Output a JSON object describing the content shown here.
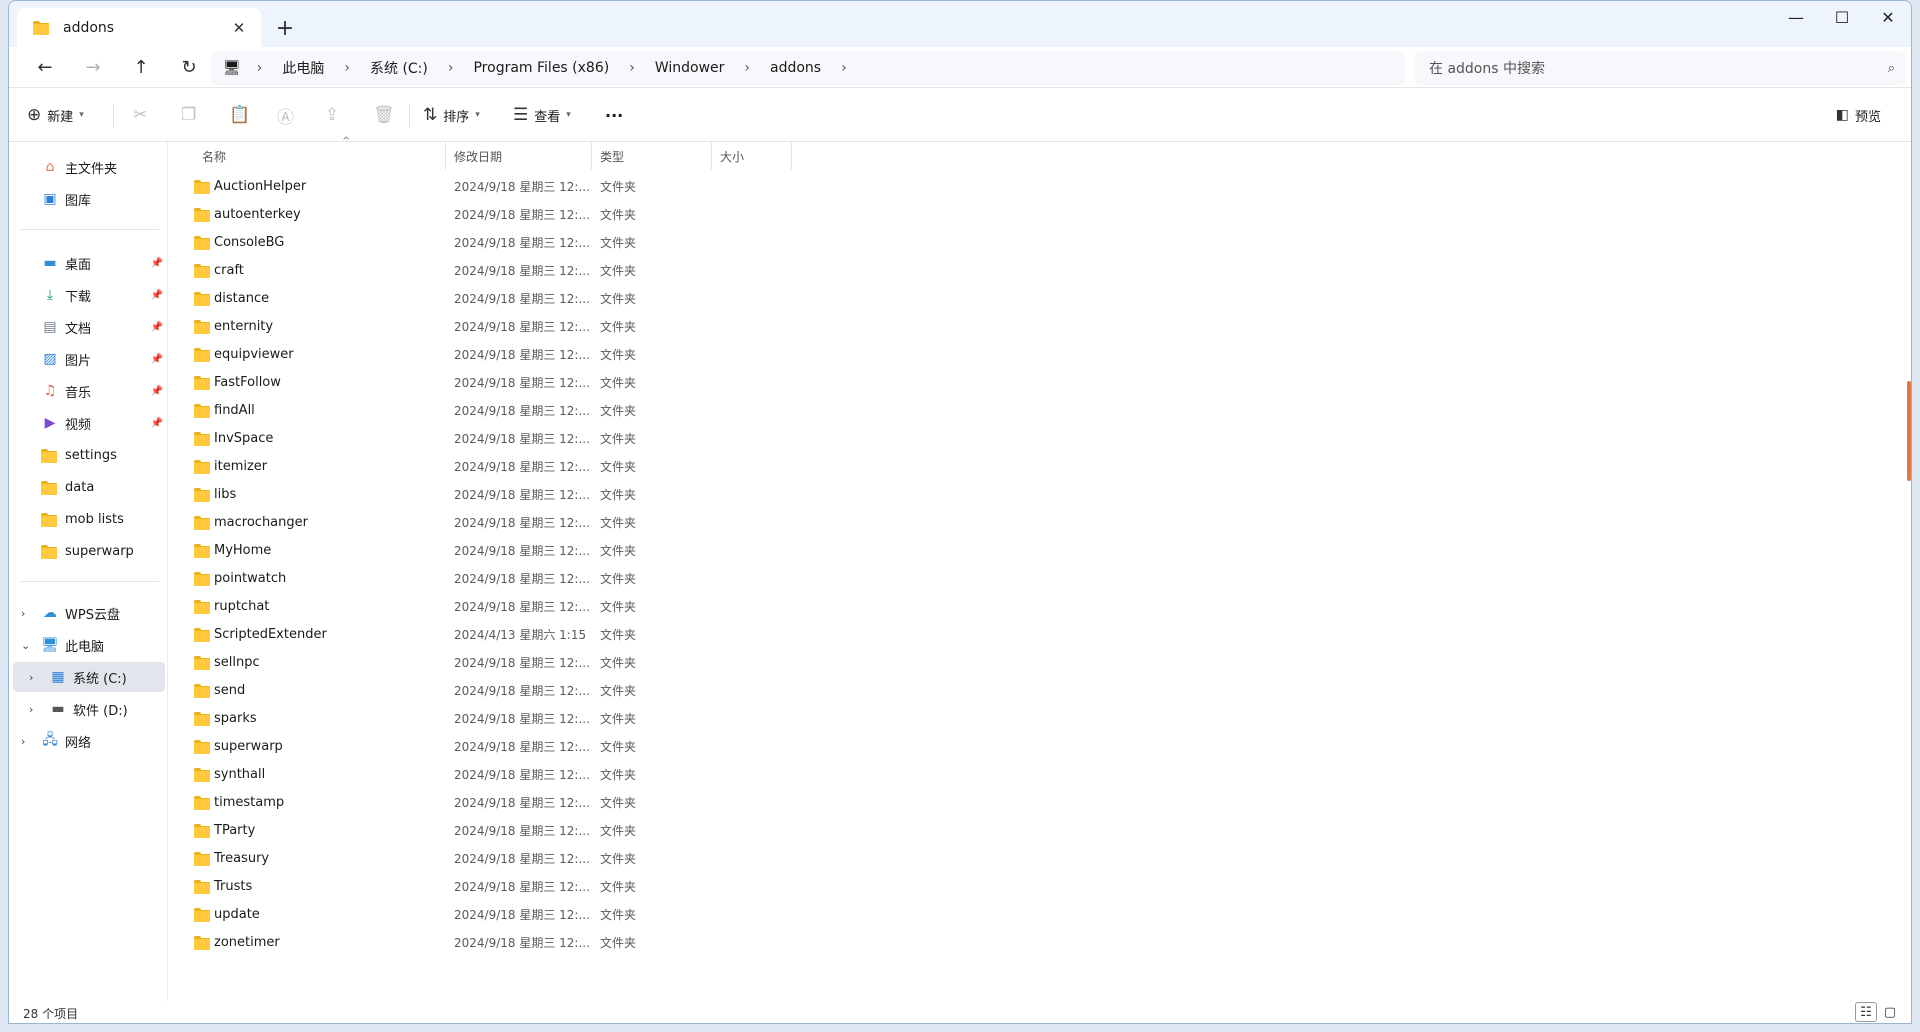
{
  "tab": {
    "title": "addons",
    "close": "✕",
    "new_tab": "+"
  },
  "window_controls": {
    "minimize": "—",
    "maximize": "☐",
    "close": "✕"
  },
  "nav": {
    "back": "←",
    "forward": "→",
    "up": "↑",
    "refresh": "↻"
  },
  "breadcrumb": [
    "此电脑",
    "系统 (C:)",
    "Program Files (x86)",
    "Windower",
    "addons"
  ],
  "search": {
    "placeholder": "在 addons 中搜索"
  },
  "toolbar": {
    "new_label": "新建",
    "sort_label": "排序",
    "view_label": "查看",
    "more": "···",
    "preview_label": "预览"
  },
  "sidebar": {
    "quick": [
      {
        "label": "主文件夹",
        "icon": "home-icon"
      },
      {
        "label": "图库",
        "icon": "gallery-icon"
      }
    ],
    "pinned": [
      {
        "label": "桌面",
        "icon": "desktop-icon",
        "color": "#2f8fd8"
      },
      {
        "label": "下载",
        "icon": "download-icon",
        "color": "#1a9b58"
      },
      {
        "label": "文档",
        "icon": "document-icon",
        "color": "#6b7b8c"
      },
      {
        "label": "图片",
        "icon": "pictures-icon",
        "color": "#2f7fd8"
      },
      {
        "label": "音乐",
        "icon": "music-icon",
        "color": "#e0634a"
      },
      {
        "label": "视频",
        "icon": "video-icon",
        "color": "#7a4bd0"
      }
    ],
    "folders": [
      "settings",
      "data",
      "mob lists",
      "superwarp"
    ],
    "tree": [
      {
        "label": "WPS云盘",
        "icon": "cloud-icon"
      },
      {
        "label": "此电脑",
        "icon": "computer-icon"
      },
      {
        "label": "系统 (C:)",
        "icon": "drive-c-icon"
      },
      {
        "label": "软件 (D:)",
        "icon": "drive-d-icon"
      },
      {
        "label": "网络",
        "icon": "network-icon"
      }
    ]
  },
  "columns": {
    "name": "名称",
    "date": "修改日期",
    "type": "类型",
    "size": "大小"
  },
  "files": [
    {
      "name": "AuctionHelper",
      "date": "2024/9/18 星期三 12:...",
      "type": "文件夹"
    },
    {
      "name": "autoenterkey",
      "date": "2024/9/18 星期三 12:...",
      "type": "文件夹"
    },
    {
      "name": "ConsoleBG",
      "date": "2024/9/18 星期三 12:...",
      "type": "文件夹"
    },
    {
      "name": "craft",
      "date": "2024/9/18 星期三 12:...",
      "type": "文件夹"
    },
    {
      "name": "distance",
      "date": "2024/9/18 星期三 12:...",
      "type": "文件夹"
    },
    {
      "name": "enternity",
      "date": "2024/9/18 星期三 12:...",
      "type": "文件夹"
    },
    {
      "name": "equipviewer",
      "date": "2024/9/18 星期三 12:...",
      "type": "文件夹"
    },
    {
      "name": "FastFollow",
      "date": "2024/9/18 星期三 12:...",
      "type": "文件夹"
    },
    {
      "name": "findAll",
      "date": "2024/9/18 星期三 12:...",
      "type": "文件夹"
    },
    {
      "name": "InvSpace",
      "date": "2024/9/18 星期三 12:...",
      "type": "文件夹"
    },
    {
      "name": "itemizer",
      "date": "2024/9/18 星期三 12:...",
      "type": "文件夹"
    },
    {
      "name": "libs",
      "date": "2024/9/18 星期三 12:...",
      "type": "文件夹"
    },
    {
      "name": "macrochanger",
      "date": "2024/9/18 星期三 12:...",
      "type": "文件夹"
    },
    {
      "name": "MyHome",
      "date": "2024/9/18 星期三 12:...",
      "type": "文件夹"
    },
    {
      "name": "pointwatch",
      "date": "2024/9/18 星期三 12:...",
      "type": "文件夹"
    },
    {
      "name": "ruptchat",
      "date": "2024/9/18 星期三 12:...",
      "type": "文件夹"
    },
    {
      "name": "ScriptedExtender",
      "date": "2024/4/13 星期六 1:15",
      "type": "文件夹"
    },
    {
      "name": "sellnpc",
      "date": "2024/9/18 星期三 12:...",
      "type": "文件夹"
    },
    {
      "name": "send",
      "date": "2024/9/18 星期三 12:...",
      "type": "文件夹"
    },
    {
      "name": "sparks",
      "date": "2024/9/18 星期三 12:...",
      "type": "文件夹"
    },
    {
      "name": "superwarp",
      "date": "2024/9/18 星期三 12:...",
      "type": "文件夹"
    },
    {
      "name": "synthall",
      "date": "2024/9/18 星期三 12:...",
      "type": "文件夹"
    },
    {
      "name": "timestamp",
      "date": "2024/9/18 星期三 12:...",
      "type": "文件夹"
    },
    {
      "name": "TParty",
      "date": "2024/9/18 星期三 12:...",
      "type": "文件夹"
    },
    {
      "name": "Treasury",
      "date": "2024/9/18 星期三 12:...",
      "type": "文件夹"
    },
    {
      "name": "Trusts",
      "date": "2024/9/18 星期三 12:...",
      "type": "文件夹"
    },
    {
      "name": "update",
      "date": "2024/9/18 星期三 12:...",
      "type": "文件夹"
    },
    {
      "name": "zonetimer",
      "date": "2024/9/18 星期三 12:...",
      "type": "文件夹"
    }
  ],
  "status": {
    "item_count": "28 个项目"
  },
  "colors": {
    "folder": "#ffc83d",
    "selected_row": "#e2e6ec",
    "accent": "#0067c0"
  }
}
